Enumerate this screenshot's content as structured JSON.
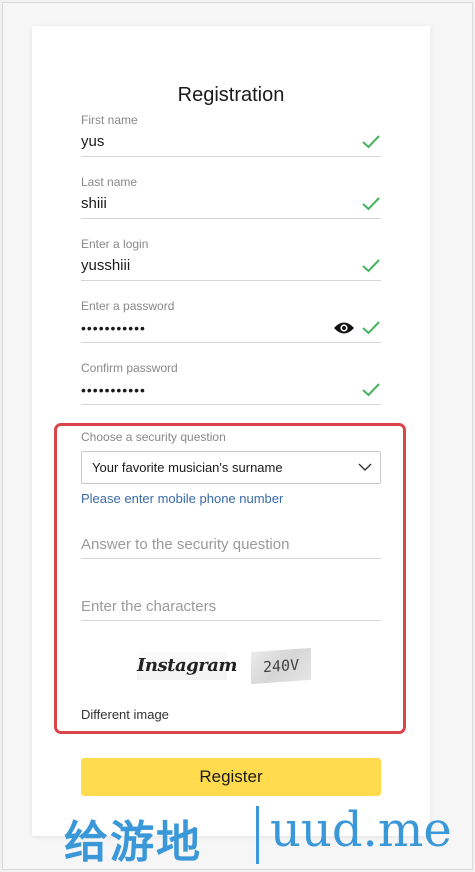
{
  "page": {
    "title": "Registration"
  },
  "fields": [
    {
      "label": "First name",
      "value": "yus"
    },
    {
      "label": "Last name",
      "value": "shiii"
    },
    {
      "label": "Enter a login",
      "value": "yusshiii"
    },
    {
      "label": "Enter a password",
      "value": "•••••••••••"
    },
    {
      "label": "Confirm password",
      "value": "•••••••••••"
    }
  ],
  "security": {
    "label": "Choose a security question",
    "selected": "Your favorite musician's surname",
    "phone_link": "Please enter mobile phone number",
    "answer_placeholder": "Answer to the security question",
    "captcha_placeholder": "Enter the characters",
    "captcha_word_1": "Instagram",
    "captcha_word_2": "240V",
    "different_image": "Different image"
  },
  "register_label": "Register",
  "watermark": {
    "zh": "给游地",
    "en": "uud.me"
  },
  "colors": {
    "check": "#46b35e",
    "highlight_border": "#d9464a",
    "button": "#ffdb4d",
    "link": "#3a6aa9"
  }
}
